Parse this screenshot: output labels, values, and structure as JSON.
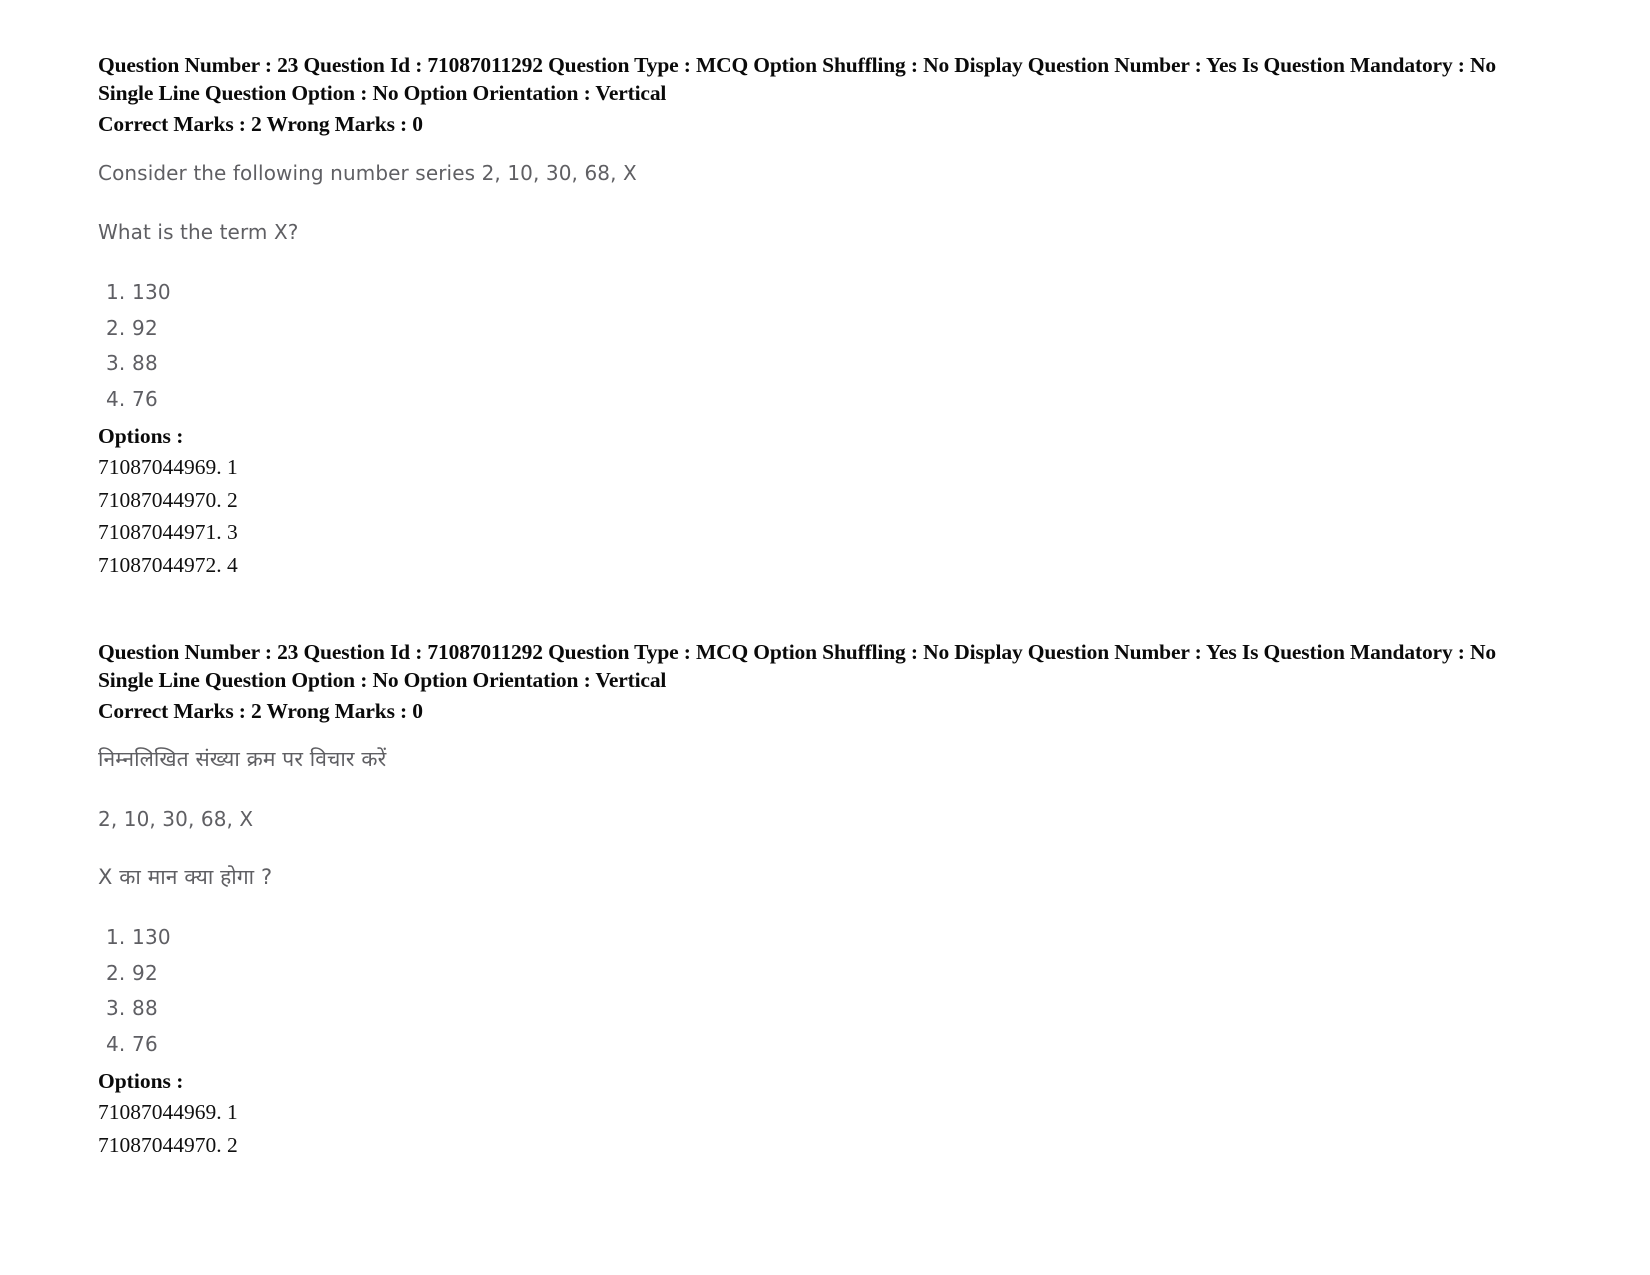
{
  "document": {
    "sections": [
      {
        "id": "section-english",
        "meta": {
          "line1": "Question Number : 23 Question Id : 71087011292 Question Type : MCQ Option Shuffling : No Display Question Number : Yes Is Question Mandatory : No Single Line Question Option : No Option Orientation : Vertical",
          "marks": "Correct Marks : 2 Wrong Marks : 0"
        },
        "question": {
          "stem": "Consider the following number series 2, 10, 30, 68, X",
          "ask": "What is the term X?"
        },
        "choices": [
          "1. 130",
          "2. 92",
          "3. 88",
          "4. 76"
        ],
        "options_label": "Options :",
        "option_ids": [
          "71087044969. 1",
          "71087044970. 2",
          "71087044971. 3",
          "71087044972. 4"
        ]
      },
      {
        "id": "section-hindi",
        "meta": {
          "line1": "Question Number : 23 Question Id : 71087011292 Question Type : MCQ Option Shuffling : No Display Question Number : Yes Is Question Mandatory : No Single Line Question Option : No Option Orientation : Vertical",
          "marks": "Correct Marks : 2 Wrong Marks : 0"
        },
        "question": {
          "stem": "निम्नलिखित संख्या क्रम पर विचार करें",
          "series": "2, 10, 30, 68, X",
          "ask": "X का मान क्या होगा ?"
        },
        "choices": [
          "1. 130",
          "2. 92",
          "3. 88",
          "4. 76"
        ],
        "options_label": "Options :",
        "option_ids": [
          "71087044969. 1",
          "71087044970. 2"
        ]
      }
    ]
  },
  "colors": {
    "page_background": "#ffffff",
    "meta_text": "#0a0a0a",
    "scanned_text": "#56565a",
    "option_id_text": "#101010"
  }
}
